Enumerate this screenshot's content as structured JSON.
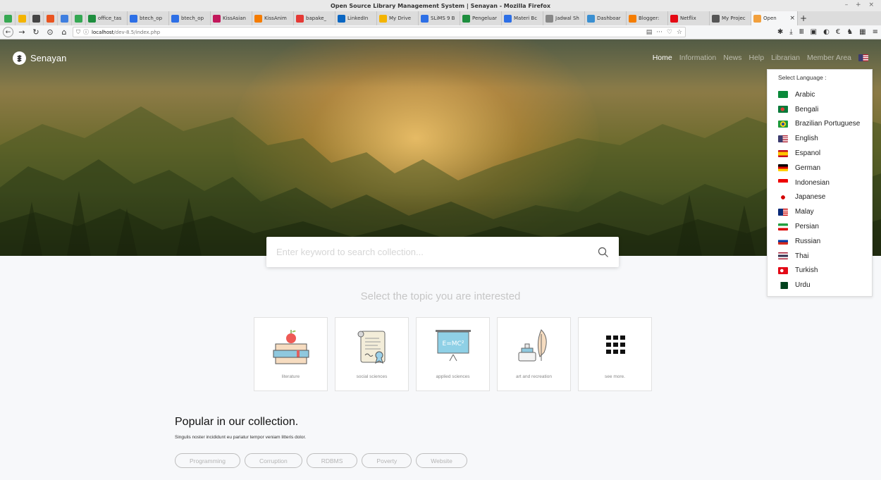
{
  "window": {
    "title": "Open Source Library Management System | Senayan - Mozilla Firefox",
    "controls": "– + ×"
  },
  "pinned_tabs": [
    {
      "icon": "drive-green-icon",
      "color": "#36a852"
    },
    {
      "icon": "drive-icon",
      "color": "#f4b400"
    },
    {
      "icon": "globe-icon",
      "color": "#444444"
    },
    {
      "icon": "ubuntu-icon",
      "color": "#e95420"
    },
    {
      "icon": "arrow-a-icon",
      "color": "#3f7fe0"
    },
    {
      "icon": "location-icon",
      "color": "#34a853"
    }
  ],
  "tabs": [
    {
      "label": "office_tas",
      "icon": "sheets-icon",
      "color": "#1e8e3e"
    },
    {
      "label": "btech_op",
      "icon": "docs-icon",
      "color": "#2d6fe6"
    },
    {
      "label": "btech_op",
      "icon": "docs-icon",
      "color": "#2d6fe6"
    },
    {
      "label": "KissAsian",
      "icon": "kiss-icon",
      "color": "#c2185b"
    },
    {
      "label": "KissAnim",
      "icon": "kiss-icon",
      "color": "#f57c00"
    },
    {
      "label": "bapake_",
      "icon": "ring-icon",
      "color": "#e53935"
    },
    {
      "label": "LinkedIn",
      "icon": "linkedin-icon",
      "color": "#0a66c2"
    },
    {
      "label": "My Drive",
      "icon": "drive-icon",
      "color": "#f4b400"
    },
    {
      "label": "SLiMS 9 B",
      "icon": "docs-icon",
      "color": "#2d6fe6"
    },
    {
      "label": "Pengeluar",
      "icon": "sheets-icon",
      "color": "#1e8e3e"
    },
    {
      "label": "Materi Bc",
      "icon": "docs-icon",
      "color": "#2d6fe6"
    },
    {
      "label": "Jadwal Sh",
      "icon": "link-icon",
      "color": "#888888"
    },
    {
      "label": "Dashboar",
      "icon": "wordpress-icon",
      "color": "#3a8fd1"
    },
    {
      "label": "Blogger:",
      "icon": "blogger-icon",
      "color": "#f57d00"
    },
    {
      "label": "Netflix",
      "icon": "netflix-icon",
      "color": "#e50914"
    },
    {
      "label": "My Projec",
      "icon": "project-icon",
      "color": "#555555"
    },
    {
      "label": "Open",
      "icon": "slims-icon",
      "color": "#f2a03d",
      "active": true,
      "close": "×"
    }
  ],
  "newtab": "+",
  "url": {
    "host": "localhost",
    "path": "/dev-8.5/index.php",
    "more": "···"
  },
  "site": {
    "brand": "Senayan",
    "menu": [
      "Home",
      "Information",
      "News",
      "Help",
      "Librarian",
      "Member Area"
    ],
    "active_menu": "Home"
  },
  "language": {
    "header": "Select Language :",
    "options": [
      "Arabic",
      "Bengali",
      "Brazilian Portuguese",
      "English",
      "Espanol",
      "German",
      "Indonesian",
      "Japanese",
      "Malay",
      "Persian",
      "Russian",
      "Thai",
      "Turkish",
      "Urdu"
    ]
  },
  "search": {
    "placeholder": "Enter keyword to search collection..."
  },
  "topics": {
    "heading": "Select the topic you are interested",
    "items": [
      {
        "label": "literature",
        "icon": "books-apple-icon"
      },
      {
        "label": "social sciences",
        "icon": "certificate-icon"
      },
      {
        "label": "applied sciences",
        "icon": "blackboard-emc2-icon",
        "board_text": "E=MC²"
      },
      {
        "label": "art and recreation",
        "icon": "ink-feather-icon"
      },
      {
        "label": "see more.",
        "icon": "grid-dots-icon"
      }
    ]
  },
  "popular": {
    "title": "Popular in our collection.",
    "subtitle": "Singulis noster incididunt eu pariatur tempor veniam litteris dolor.",
    "chips": [
      "Programming",
      "Corruption",
      "RDBMS",
      "Poverty",
      "Website"
    ]
  }
}
